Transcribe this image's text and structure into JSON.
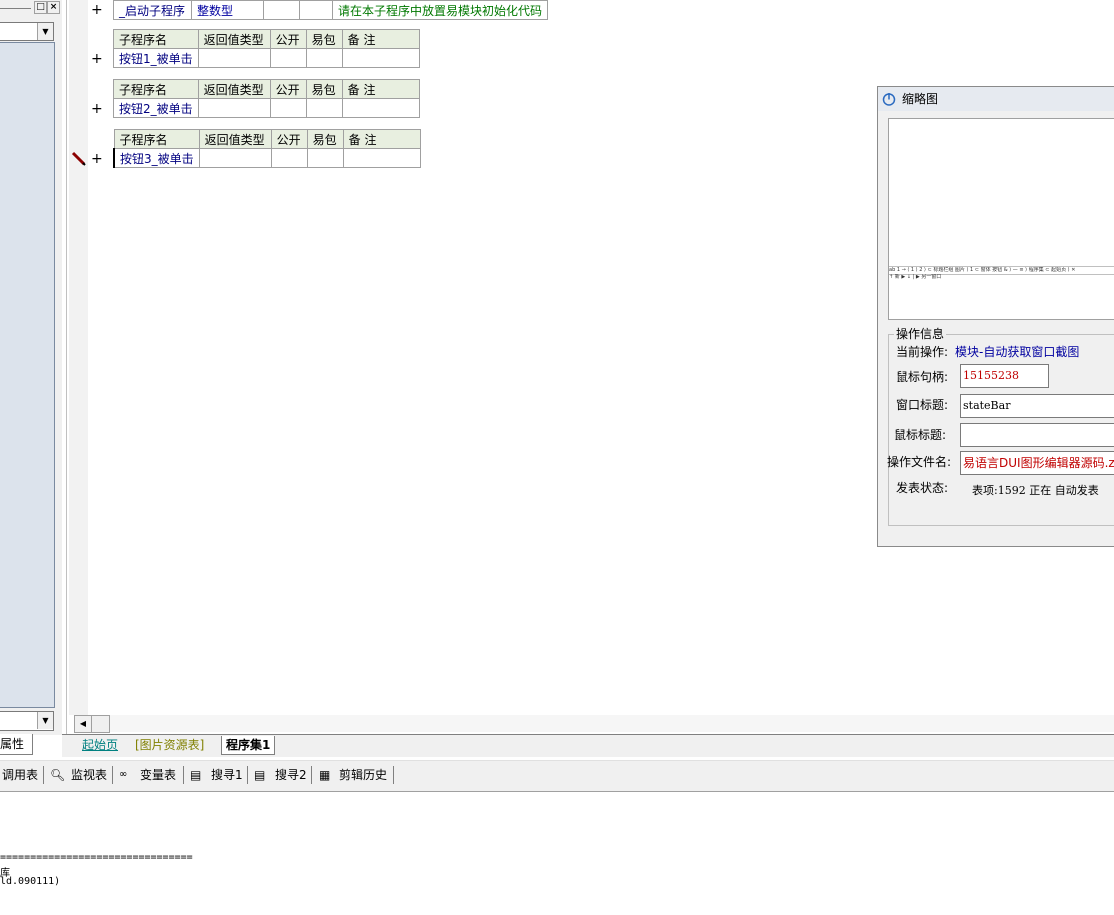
{
  "code": {
    "startup_row": {
      "name": "_启动子程序",
      "type": "整数型",
      "comment": "请在本子程序中放置易模块初始化代码"
    },
    "headers": {
      "name": "子程序名",
      "return_type": "返回值类型",
      "public": "公开",
      "easy_pkg": "易包",
      "remark": "备 注"
    },
    "subs": [
      {
        "name": "按钮1_被单击"
      },
      {
        "name": "按钮2_被单击"
      },
      {
        "name": "按钮3_被单击"
      }
    ],
    "expand_glyph": "+"
  },
  "left_panel": {
    "properties_tab": "属性"
  },
  "tabs": {
    "start": "起始页",
    "images": "[图片资源表]",
    "program_set": "程序集1"
  },
  "toolbar": {
    "call_table": "调用表",
    "watch_table": "监视表",
    "var_table": "变量表",
    "search1": "搜寻1",
    "search2": "搜寻2",
    "clip_history": "剪辑历史"
  },
  "output": {
    "line1": "================================",
    "line2": "库",
    "line3": "ld.090111)"
  },
  "thumbnail": {
    "title": "缩略图",
    "mini_strip": "ab 1 → ⟨ 1 ⟩ 2 ⟩ ⊂ 标题栏组 图片 ⟩ 1 ⊂ 窗体 按钮 & ⟩ — ≡ ⟩ 程序集 ⊂ 起始页 ⟩ ✕",
    "mini_strip2": "↑ 新 ▶ ↓ | ▶ 另一窗口",
    "group_title": "操作信息",
    "current_op_label": "当前操作:",
    "current_op_value": "模块-自动获取窗口截图",
    "mouse_handle_label": "鼠标句柄:",
    "mouse_handle_value": "15155238",
    "window_title_label": "窗口标题:",
    "window_title_value": "stateBar",
    "mouse_title_label": "鼠标标题:",
    "mouse_title_value": "",
    "file_name_label": "操作文件名:",
    "file_name_value": "易语言DUI图形编辑器源码.zip",
    "publish_label": "发表状态:",
    "publish_value": "表项:1592 正在 自动发表"
  }
}
